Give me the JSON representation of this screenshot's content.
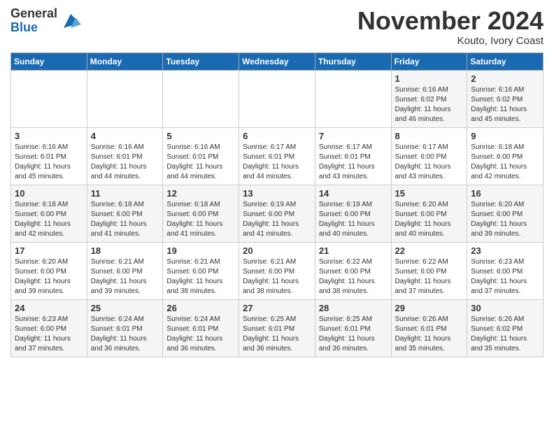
{
  "header": {
    "logo_general": "General",
    "logo_blue": "Blue",
    "month_title": "November 2024",
    "location": "Kouto, Ivory Coast"
  },
  "days_of_week": [
    "Sunday",
    "Monday",
    "Tuesday",
    "Wednesday",
    "Thursday",
    "Friday",
    "Saturday"
  ],
  "weeks": [
    [
      {
        "day": "",
        "info": ""
      },
      {
        "day": "",
        "info": ""
      },
      {
        "day": "",
        "info": ""
      },
      {
        "day": "",
        "info": ""
      },
      {
        "day": "",
        "info": ""
      },
      {
        "day": "1",
        "info": "Sunrise: 6:16 AM\nSunset: 6:02 PM\nDaylight: 11 hours\nand 46 minutes."
      },
      {
        "day": "2",
        "info": "Sunrise: 6:16 AM\nSunset: 6:02 PM\nDaylight: 11 hours\nand 45 minutes."
      }
    ],
    [
      {
        "day": "3",
        "info": "Sunrise: 6:16 AM\nSunset: 6:01 PM\nDaylight: 11 hours\nand 45 minutes."
      },
      {
        "day": "4",
        "info": "Sunrise: 6:16 AM\nSunset: 6:01 PM\nDaylight: 11 hours\nand 44 minutes."
      },
      {
        "day": "5",
        "info": "Sunrise: 6:16 AM\nSunset: 6:01 PM\nDaylight: 11 hours\nand 44 minutes."
      },
      {
        "day": "6",
        "info": "Sunrise: 6:17 AM\nSunset: 6:01 PM\nDaylight: 11 hours\nand 44 minutes."
      },
      {
        "day": "7",
        "info": "Sunrise: 6:17 AM\nSunset: 6:01 PM\nDaylight: 11 hours\nand 43 minutes."
      },
      {
        "day": "8",
        "info": "Sunrise: 6:17 AM\nSunset: 6:00 PM\nDaylight: 11 hours\nand 43 minutes."
      },
      {
        "day": "9",
        "info": "Sunrise: 6:18 AM\nSunset: 6:00 PM\nDaylight: 11 hours\nand 42 minutes."
      }
    ],
    [
      {
        "day": "10",
        "info": "Sunrise: 6:18 AM\nSunset: 6:00 PM\nDaylight: 11 hours\nand 42 minutes."
      },
      {
        "day": "11",
        "info": "Sunrise: 6:18 AM\nSunset: 6:00 PM\nDaylight: 11 hours\nand 41 minutes."
      },
      {
        "day": "12",
        "info": "Sunrise: 6:18 AM\nSunset: 6:00 PM\nDaylight: 11 hours\nand 41 minutes."
      },
      {
        "day": "13",
        "info": "Sunrise: 6:19 AM\nSunset: 6:00 PM\nDaylight: 11 hours\nand 41 minutes."
      },
      {
        "day": "14",
        "info": "Sunrise: 6:19 AM\nSunset: 6:00 PM\nDaylight: 11 hours\nand 40 minutes."
      },
      {
        "day": "15",
        "info": "Sunrise: 6:20 AM\nSunset: 6:00 PM\nDaylight: 11 hours\nand 40 minutes."
      },
      {
        "day": "16",
        "info": "Sunrise: 6:20 AM\nSunset: 6:00 PM\nDaylight: 11 hours\nand 39 minutes."
      }
    ],
    [
      {
        "day": "17",
        "info": "Sunrise: 6:20 AM\nSunset: 6:00 PM\nDaylight: 11 hours\nand 39 minutes."
      },
      {
        "day": "18",
        "info": "Sunrise: 6:21 AM\nSunset: 6:00 PM\nDaylight: 11 hours\nand 39 minutes."
      },
      {
        "day": "19",
        "info": "Sunrise: 6:21 AM\nSunset: 6:00 PM\nDaylight: 11 hours\nand 38 minutes."
      },
      {
        "day": "20",
        "info": "Sunrise: 6:21 AM\nSunset: 6:00 PM\nDaylight: 11 hours\nand 38 minutes."
      },
      {
        "day": "21",
        "info": "Sunrise: 6:22 AM\nSunset: 6:00 PM\nDaylight: 11 hours\nand 38 minutes."
      },
      {
        "day": "22",
        "info": "Sunrise: 6:22 AM\nSunset: 6:00 PM\nDaylight: 11 hours\nand 37 minutes."
      },
      {
        "day": "23",
        "info": "Sunrise: 6:23 AM\nSunset: 6:00 PM\nDaylight: 11 hours\nand 37 minutes."
      }
    ],
    [
      {
        "day": "24",
        "info": "Sunrise: 6:23 AM\nSunset: 6:00 PM\nDaylight: 11 hours\nand 37 minutes."
      },
      {
        "day": "25",
        "info": "Sunrise: 6:24 AM\nSunset: 6:01 PM\nDaylight: 11 hours\nand 36 minutes."
      },
      {
        "day": "26",
        "info": "Sunrise: 6:24 AM\nSunset: 6:01 PM\nDaylight: 11 hours\nand 36 minutes."
      },
      {
        "day": "27",
        "info": "Sunrise: 6:25 AM\nSunset: 6:01 PM\nDaylight: 11 hours\nand 36 minutes."
      },
      {
        "day": "28",
        "info": "Sunrise: 6:25 AM\nSunset: 6:01 PM\nDaylight: 11 hours\nand 36 minutes."
      },
      {
        "day": "29",
        "info": "Sunrise: 6:26 AM\nSunset: 6:01 PM\nDaylight: 11 hours\nand 35 minutes."
      },
      {
        "day": "30",
        "info": "Sunrise: 6:26 AM\nSunset: 6:02 PM\nDaylight: 11 hours\nand 35 minutes."
      }
    ]
  ]
}
